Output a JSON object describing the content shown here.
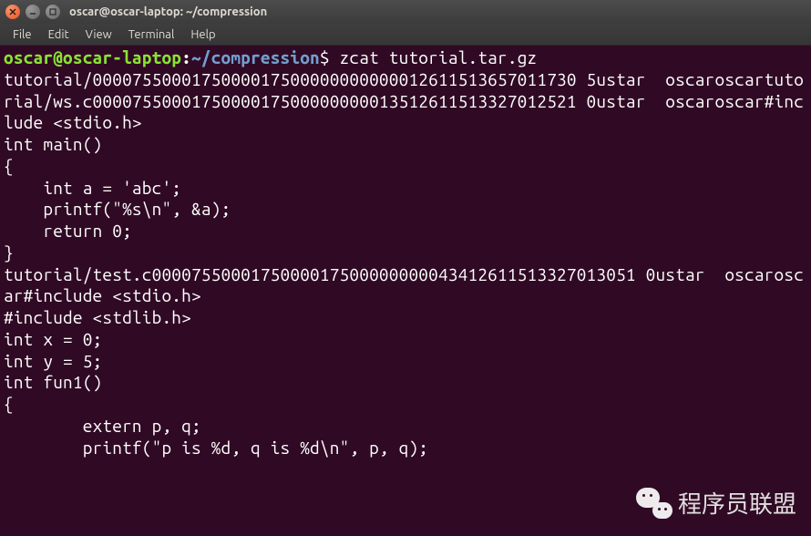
{
  "window": {
    "title": "oscar@oscar-laptop: ~/compression"
  },
  "menu": {
    "file": "File",
    "edit": "Edit",
    "view": "View",
    "terminal": "Terminal",
    "help": "Help"
  },
  "prompt": {
    "user_host": "oscar@oscar-laptop",
    "colon": ":",
    "path": "~/compression",
    "symbol": "$"
  },
  "command": "zcat tutorial.tar.gz",
  "output": {
    "line1": "tutorial/0000755000175000017500000000000012611513657011730 5ustar  oscaroscartutorial/ws.c0000755000175000017500000000013512611513327012521 0ustar  oscaroscar#include <stdio.h>",
    "blank1": "",
    "line2": "int main()",
    "line3": "{",
    "line4": "    int a = 'abc';",
    "line5": "    printf(\"%s\\n\", &a);",
    "blank2": "",
    "line6": "    return 0;",
    "line7": "}",
    "line8": "tutorial/test.c0000755000175000017500000000043412611513327013051 0ustar  oscaroscar#include <stdio.h>",
    "line9": "#include <stdlib.h>",
    "blank3": "",
    "line10": "int x = 0;",
    "line11": "int y = 5;",
    "blank4": "",
    "line12": "int fun1()",
    "line13": "{",
    "line14": "        extern p, q;",
    "line15": "        printf(\"p is %d, q is %d\\n\", p, q);"
  },
  "watermark": {
    "text": "程序员联盟"
  }
}
